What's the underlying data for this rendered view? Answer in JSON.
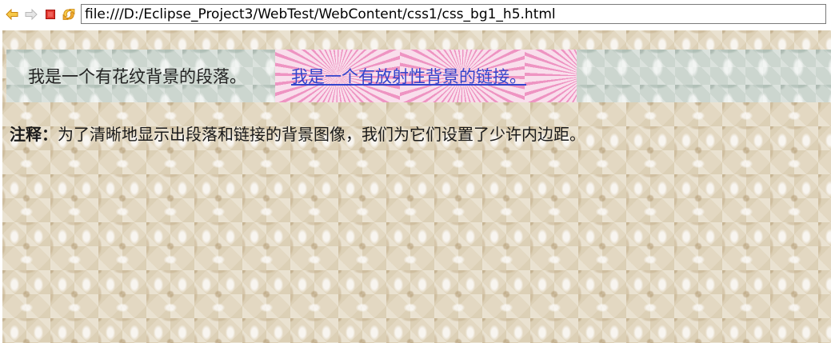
{
  "browser": {
    "url": "file:///D:/Eclipse_Project3/WebTest/WebContent/css1/css_bg1_h5.html",
    "icons": {
      "back": "back-arrow-icon",
      "forward": "forward-arrow-icon",
      "stop": "stop-icon",
      "refresh": "refresh-icon"
    },
    "colors": {
      "back": "#e8a317",
      "forward": "#c8c8c8",
      "stop": "#d9201e",
      "refresh": "#e8a317"
    }
  },
  "page": {
    "paragraph_text": "我是一个有花纹背景的段落。",
    "link_text": "我是一个有放射性背景的链接。",
    "note_label": "注释：",
    "note_text": "为了清晰地显示出段落和链接的背景图像，我们为它们设置了少许内边距。"
  }
}
